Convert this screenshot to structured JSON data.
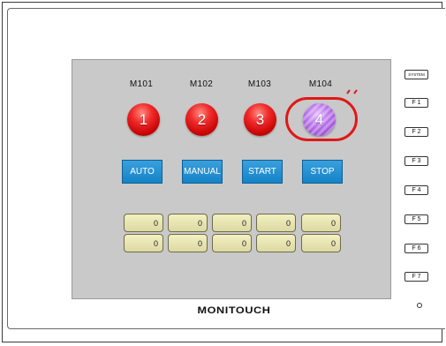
{
  "lamps": [
    {
      "label": "M101",
      "number": "1",
      "color": "#e01e1e"
    },
    {
      "label": "M102",
      "number": "2",
      "color": "#e01e1e"
    },
    {
      "label": "M103",
      "number": "3",
      "color": "#e01e1e"
    },
    {
      "label": "M104",
      "number": "4",
      "color": "#a855e0"
    }
  ],
  "buttons": {
    "auto": "AUTO",
    "manual": "MANUAL",
    "start": "START",
    "stop": "STOP"
  },
  "numeric_displays": {
    "row1": [
      "0",
      "0",
      "0",
      "0",
      "0"
    ],
    "row2": [
      "0",
      "0",
      "0",
      "0",
      "0"
    ]
  },
  "brand": "MONITOUCH",
  "function_keys": [
    "SYSTEM",
    "F 1",
    "F 2",
    "F 3",
    "F 4",
    "F 5",
    "F 6",
    "F 7"
  ],
  "colors": {
    "button_blue": "#1f8fd4",
    "highlight_red": "#e01818",
    "screen_gray": "#c9c9c9",
    "display_yellow": "#ece8b5"
  }
}
